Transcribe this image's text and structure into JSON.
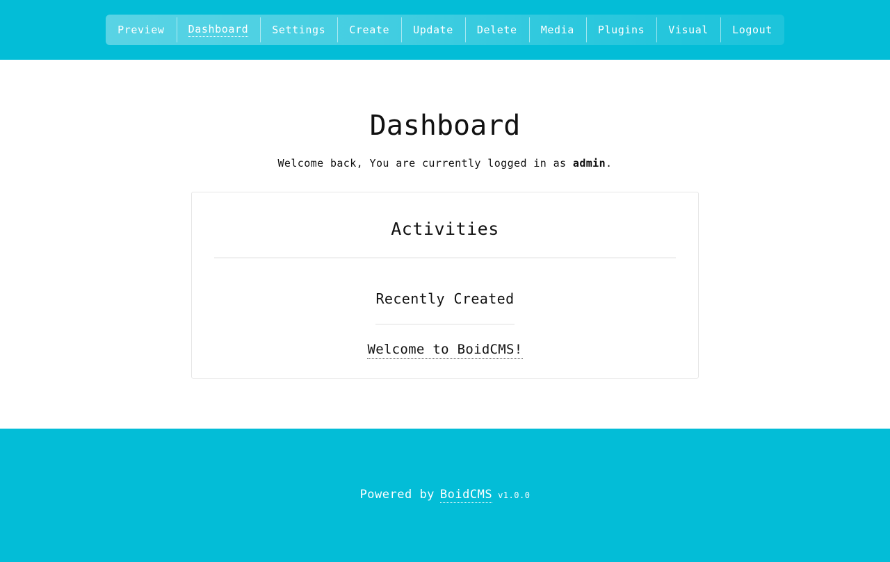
{
  "colors": {
    "brand_cyan": "#03bdd7",
    "page_background": "#ffffff",
    "text": "#111111",
    "card_border": "#e6e6e6",
    "rule": "#f0f0f0",
    "nav_text": "#ffffff"
  },
  "header": {
    "nav_items": [
      {
        "label": "Preview",
        "name": "nav-item-preview",
        "active": false
      },
      {
        "label": "Dashboard",
        "name": "nav-item-dashboard",
        "active": true
      },
      {
        "label": "Settings",
        "name": "nav-item-settings",
        "active": false
      },
      {
        "label": "Create",
        "name": "nav-item-create",
        "active": false
      },
      {
        "label": "Update",
        "name": "nav-item-update",
        "active": false
      },
      {
        "label": "Delete",
        "name": "nav-item-delete",
        "active": false
      },
      {
        "label": "Media",
        "name": "nav-item-media",
        "active": false
      },
      {
        "label": "Plugins",
        "name": "nav-item-plugins",
        "active": false
      },
      {
        "label": "Visual",
        "name": "nav-item-visual",
        "active": false
      },
      {
        "label": "Logout",
        "name": "nav-item-logout",
        "active": false
      }
    ]
  },
  "main": {
    "page_title": "Dashboard",
    "welcome": {
      "prefix": "Welcome back, You are currently logged in as ",
      "username": "admin",
      "suffix": "."
    },
    "card": {
      "title": "Activities",
      "section_title": "Recently Created",
      "recent_items": [
        {
          "label": "Welcome to BoidCMS!"
        }
      ]
    }
  },
  "footer": {
    "powered_by": "Powered by",
    "brand": "BoidCMS",
    "version": "v1.0.0"
  }
}
